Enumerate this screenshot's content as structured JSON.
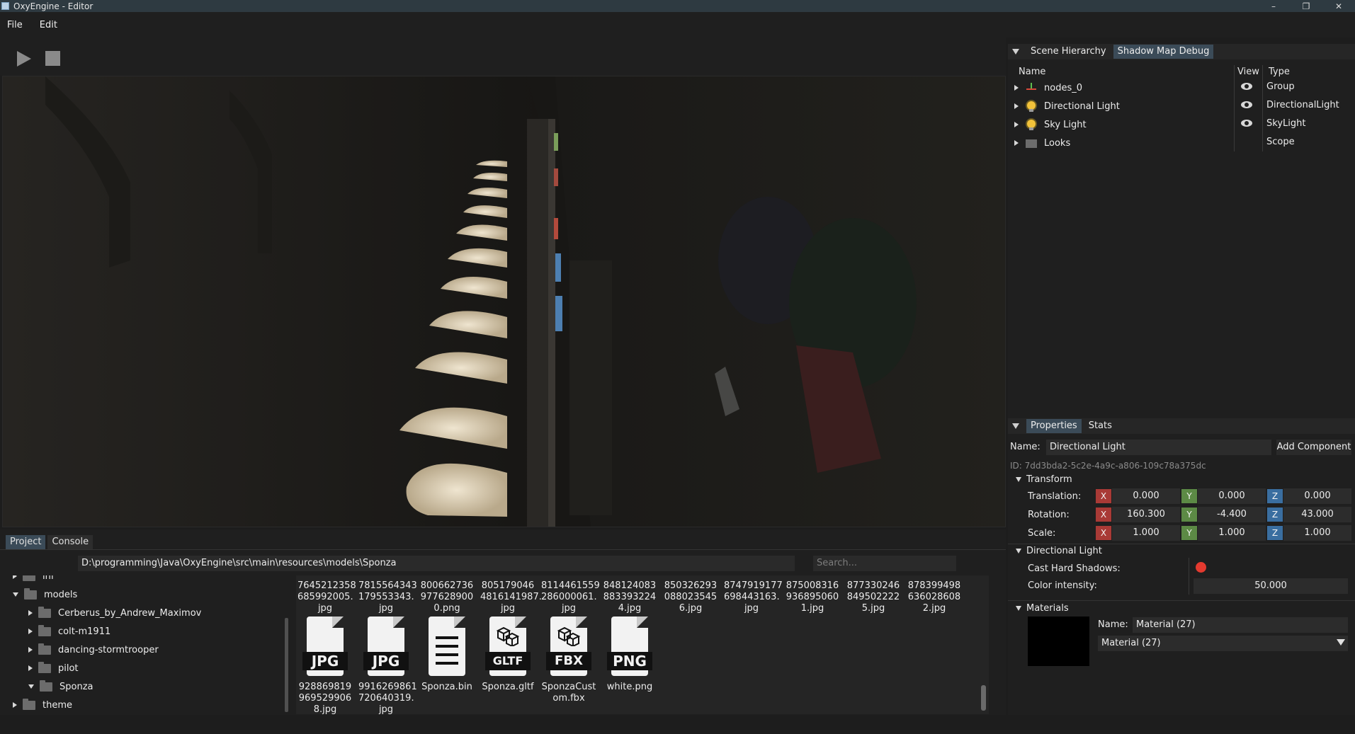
{
  "window": {
    "title": "OxyEngine - Editor",
    "minimize": "–",
    "maximize": "❐",
    "close": "✕"
  },
  "menu": [
    "File",
    "Edit"
  ],
  "toolbar": {
    "play_icon": "play-icon",
    "stop_icon": "stop-icon"
  },
  "bottom": {
    "tabs": [
      "Project",
      "Console"
    ],
    "path": "D:\\programming\\Java\\OxyEngine\\src\\main\\resources\\models\\Sponza",
    "search_placeholder": "Search...",
    "tree": [
      {
        "label": "inf",
        "expanded": false
      },
      {
        "label": "models",
        "expanded": true
      },
      {
        "label": "Cerberus_by_Andrew_Maximov",
        "expanded": false
      },
      {
        "label": "colt-m1911",
        "expanded": false
      },
      {
        "label": "dancing-stormtrooper",
        "expanded": false
      },
      {
        "label": "pilot",
        "expanded": false
      },
      {
        "label": "Sponza",
        "expanded": true
      },
      {
        "label": "theme",
        "expanded": false
      }
    ],
    "files_top": [
      "7645212358\n685992005.\njpg",
      "7815564343\n179553343.\njpg",
      "800662736\n977628900\n0.png",
      "805179046\n4816141987.\njpg",
      "8114461559\n286000061.\njpg",
      "848124083\n883393224\n4.jpg",
      "850326293\n088023545\n6.jpg",
      "8747919177\n698443163.\njpg",
      "875008316\n936895060\n1.jpg",
      "877330246\n849502222\n5.jpg",
      "878399498\n636028608\n2.jpg"
    ],
    "files_bottom": [
      {
        "tag": "JPG",
        "label": "928869819\n969529906\n8.jpg"
      },
      {
        "tag": "JPG",
        "label": "9916269861\n720640319.\njpg"
      },
      {
        "tag": "",
        "label": "Sponza.bin"
      },
      {
        "tag": "GLTF",
        "label": "Sponza.gltf"
      },
      {
        "tag": "FBX",
        "label": "SponzaCust\nom.fbx"
      },
      {
        "tag": "PNG",
        "label": "white.png"
      }
    ]
  },
  "hierarchy": {
    "tabs": [
      "Scene Hierarchy",
      "Shadow Map Debug"
    ],
    "columns": {
      "name": "Name",
      "view": "View",
      "type": "Type"
    },
    "rows": [
      {
        "name": "nodes_0",
        "type": "Group",
        "icon": "axes-icon",
        "visible": true
      },
      {
        "name": "Directional Light",
        "type": "DirectionalLight",
        "icon": "light-bulb-icon",
        "visible": true
      },
      {
        "name": "Sky Light",
        "type": "SkyLight",
        "icon": "light-bulb-icon",
        "visible": true
      },
      {
        "name": "Looks",
        "type": "Scope",
        "icon": "folder-icon",
        "visible": false
      }
    ]
  },
  "properties": {
    "tabs": [
      "Properties",
      "Stats"
    ],
    "name_label": "Name:",
    "name_value": "Directional Light",
    "add_component": "Add Component",
    "id": "ID: 7dd3bda2-5c2e-4a9c-a806-109c78a375dc",
    "transform": {
      "title": "Transform",
      "rows": [
        {
          "label": "Translation:",
          "x": "0.000",
          "y": "0.000",
          "z": "0.000"
        },
        {
          "label": "Rotation:",
          "x": "160.300",
          "y": "-4.400",
          "z": "43.000"
        },
        {
          "label": "Scale:",
          "x": "1.000",
          "y": "1.000",
          "z": "1.000"
        }
      ],
      "axis_labels": [
        "X",
        "Y",
        "Z"
      ]
    },
    "light": {
      "title": "Directional Light",
      "cast_shadows_label": "Cast Hard Shadows:",
      "cast_shadows": true,
      "intensity_label": "Color intensity:",
      "intensity": "50.000"
    },
    "materials": {
      "title": "Materials",
      "name_label": "Name:",
      "name_value": "Material (27)",
      "selected": "Material (27)"
    }
  },
  "colors": {
    "accent_tab": "#3b4b58",
    "axis_x": "#a93a36",
    "axis_y": "#5c8a45",
    "axis_z": "#3a6ea0",
    "shadow_toggle": "#e43a2f"
  }
}
